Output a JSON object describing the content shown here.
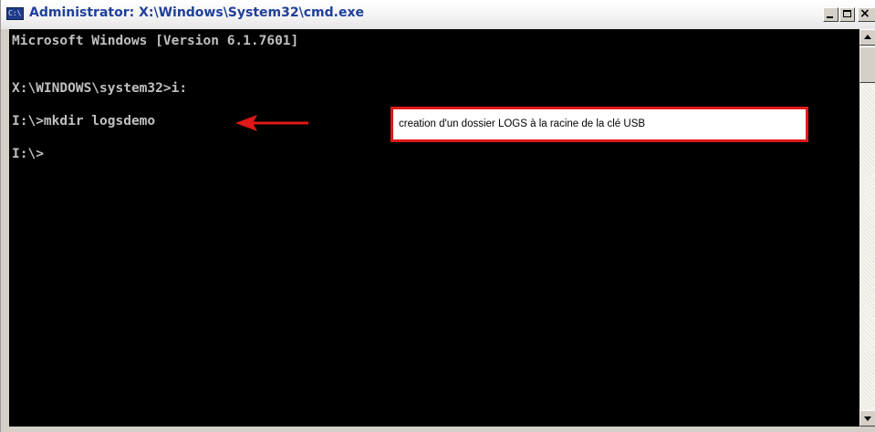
{
  "window": {
    "title": "Administrator: X:\\Windows\\System32\\cmd.exe",
    "icon": "cmd-icon",
    "icon_glyph": "C:\\",
    "controls": [
      "minimize-icon",
      "maximize-icon",
      "close-icon"
    ],
    "close_glyph": "×"
  },
  "console": {
    "background": "#000000",
    "text_color": "#c0c0c0",
    "lines": [
      "Microsoft Windows [Version 6.1.7601]",
      "",
      "X:\\WINDOWS\\system32>i:",
      "",
      "I:\\>mkdir logsdemo",
      "",
      "I:\\>"
    ]
  },
  "annotation": {
    "text": "creation d'un dossier LOGS à la racine de la clé USB",
    "color": "#e01818"
  }
}
